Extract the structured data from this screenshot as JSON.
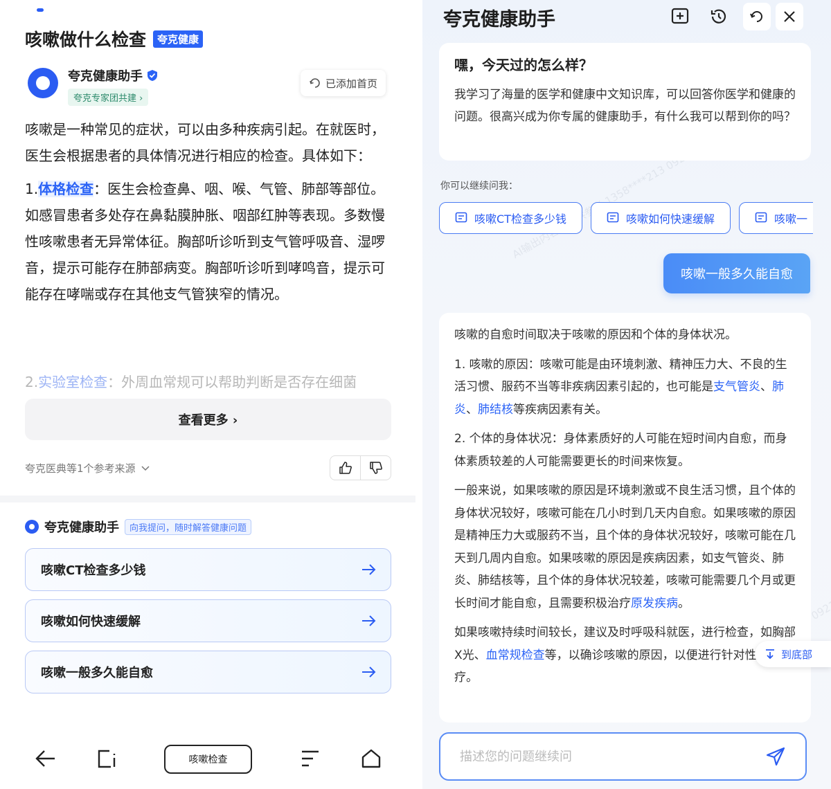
{
  "left": {
    "title": "咳嗽做什么检查",
    "brand_tag": "夸克健康",
    "author": {
      "name": "夸克健康助手",
      "sub": "夸克专家团共建 ›"
    },
    "added_home": "已添加首页",
    "intro": "咳嗽是一种常见的症状，可以由多种疾病引起。在就医时，医生会根据患者的具体情况进行相应的检查。具体如下：",
    "item1_prefix": "1.",
    "item1_link": "体格检查",
    "item1_text": "：医生会检查鼻、咽、喉、气管、肺部等部位。如感冒患者多处存在鼻黏膜肿胀、咽部红肿等表现。多数慢性咳嗽患者无异常体征。胸部听诊听到支气管呼吸音、湿啰音，提示可能存在肺部病变。胸部听诊听到哮鸣音，提示可能存在哮喘或存在其他支气管狭窄的情况。",
    "item2_prefix": "2.",
    "item2_link": "实验室检查",
    "item2_text": "：外周血常规可以帮助判断是否存在细菌",
    "more_label": "查看更多 ›",
    "refs": "夸克医典等1个参考来源",
    "assistant_name": "夸克健康助手",
    "assistant_tag": "向我提问，随时解答健康问题",
    "questions": [
      "咳嗽CT检查多少钱",
      "咳嗽如何快速缓解",
      "咳嗽一般多久能自愈"
    ],
    "search_chip": "咳嗽检查"
  },
  "right": {
    "title": "夸克健康助手",
    "welcome_title": "嘿，今天过的怎么样？",
    "welcome_text": "我学习了海量的医学和健康中文知识库，可以回答你医学和健康的问题。很高兴成为你专属的健康助手，有什么我可以帮到你的吗？",
    "continue_label": "你可以继续问我：",
    "chips": [
      "咳嗽CT检查多少钱",
      "咳嗽如何快速缓解",
      "咳嗽一"
    ],
    "user_message": "咳嗽一般多久能自愈",
    "answer": {
      "p1": "咳嗽的自愈时间取决于咳嗽的原因和个体的身体状况。",
      "p2a": "1. 咳嗽的原因：咳嗽可能是由环境刺激、精神压力大、不良的生活习惯、服药不当等非疾病因素引起的，也可能是",
      "link1": "支气管炎",
      "sep1": "、",
      "link2": "肺炎",
      "sep2": "、",
      "link3": "肺结核",
      "p2b": "等疾病因素有关。",
      "p3": "2. 个体的身体状况：身体素质好的人可能在短时间内自愈，而身体素质较差的人可能需要更长的时间来恢复。",
      "p4a": "一般来说，如果咳嗽的原因是环境刺激或不良生活习惯，且个体的身体状况较好，咳嗽可能在几小时到几天内自愈。如果咳嗽的原因是精神压力大或服药不当，且个体的身体状况较好，咳嗽可能在几天到几周内自愈。如果咳嗽的原因是疾病因素，如支气管炎、肺炎、肺结核等，且个体的身体状况较差，咳嗽可能需要几个月或更长时间才能自愈，且需要积极治疗",
      "link4": "原发疾病",
      "p4b": "。",
      "p5a": "如果咳嗽持续时间较长，建议及时呼吸科就医，进行检查，如胸部X光、",
      "link5": "血常规检查",
      "p5b": "等，以确诊咳嗽的原因，以便进行针对性的治疗。"
    },
    "to_bottom": "到底部",
    "input_placeholder": "描述您的问题继续问",
    "watermark": "AI输出内容，仅供参考 1358****213 092185"
  },
  "colors": {
    "accent": "#2b63f6",
    "tag_green": "#2c8a6b",
    "bubble": "#4a8cf7"
  },
  "icons": [
    "verified-icon",
    "refresh-icon",
    "thumbs-up-icon",
    "thumbs-down-icon",
    "arrow-right-icon",
    "back-icon",
    "tabs-icon",
    "menu-icon",
    "home-icon",
    "add-chat-icon",
    "history-icon",
    "close-icon",
    "chat-icon",
    "arrow-down-icon",
    "send-icon"
  ]
}
